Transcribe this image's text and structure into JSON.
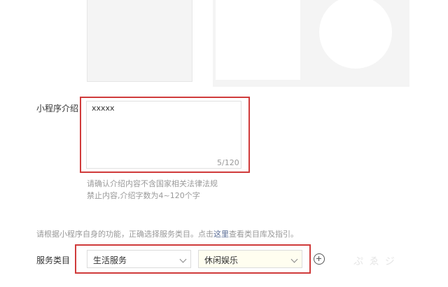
{
  "intro": {
    "label": "小程序介绍",
    "value": "xxxxx",
    "counter": "5/120",
    "hint_line1": "请确认介绍内容不含国家相关法律法规",
    "hint_line2": "禁止内容,介绍字数为4~120个字"
  },
  "category": {
    "hint_prefix": "请根据小程序自身的功能，正确选择服务类目。点击",
    "hint_link": "这里",
    "hint_suffix": "查看类目库及指引。",
    "label": "服务类目",
    "primary_value": "生活服务",
    "secondary_value": "休闲娱乐"
  },
  "watermark": "ぷ  ゑ  ジ"
}
